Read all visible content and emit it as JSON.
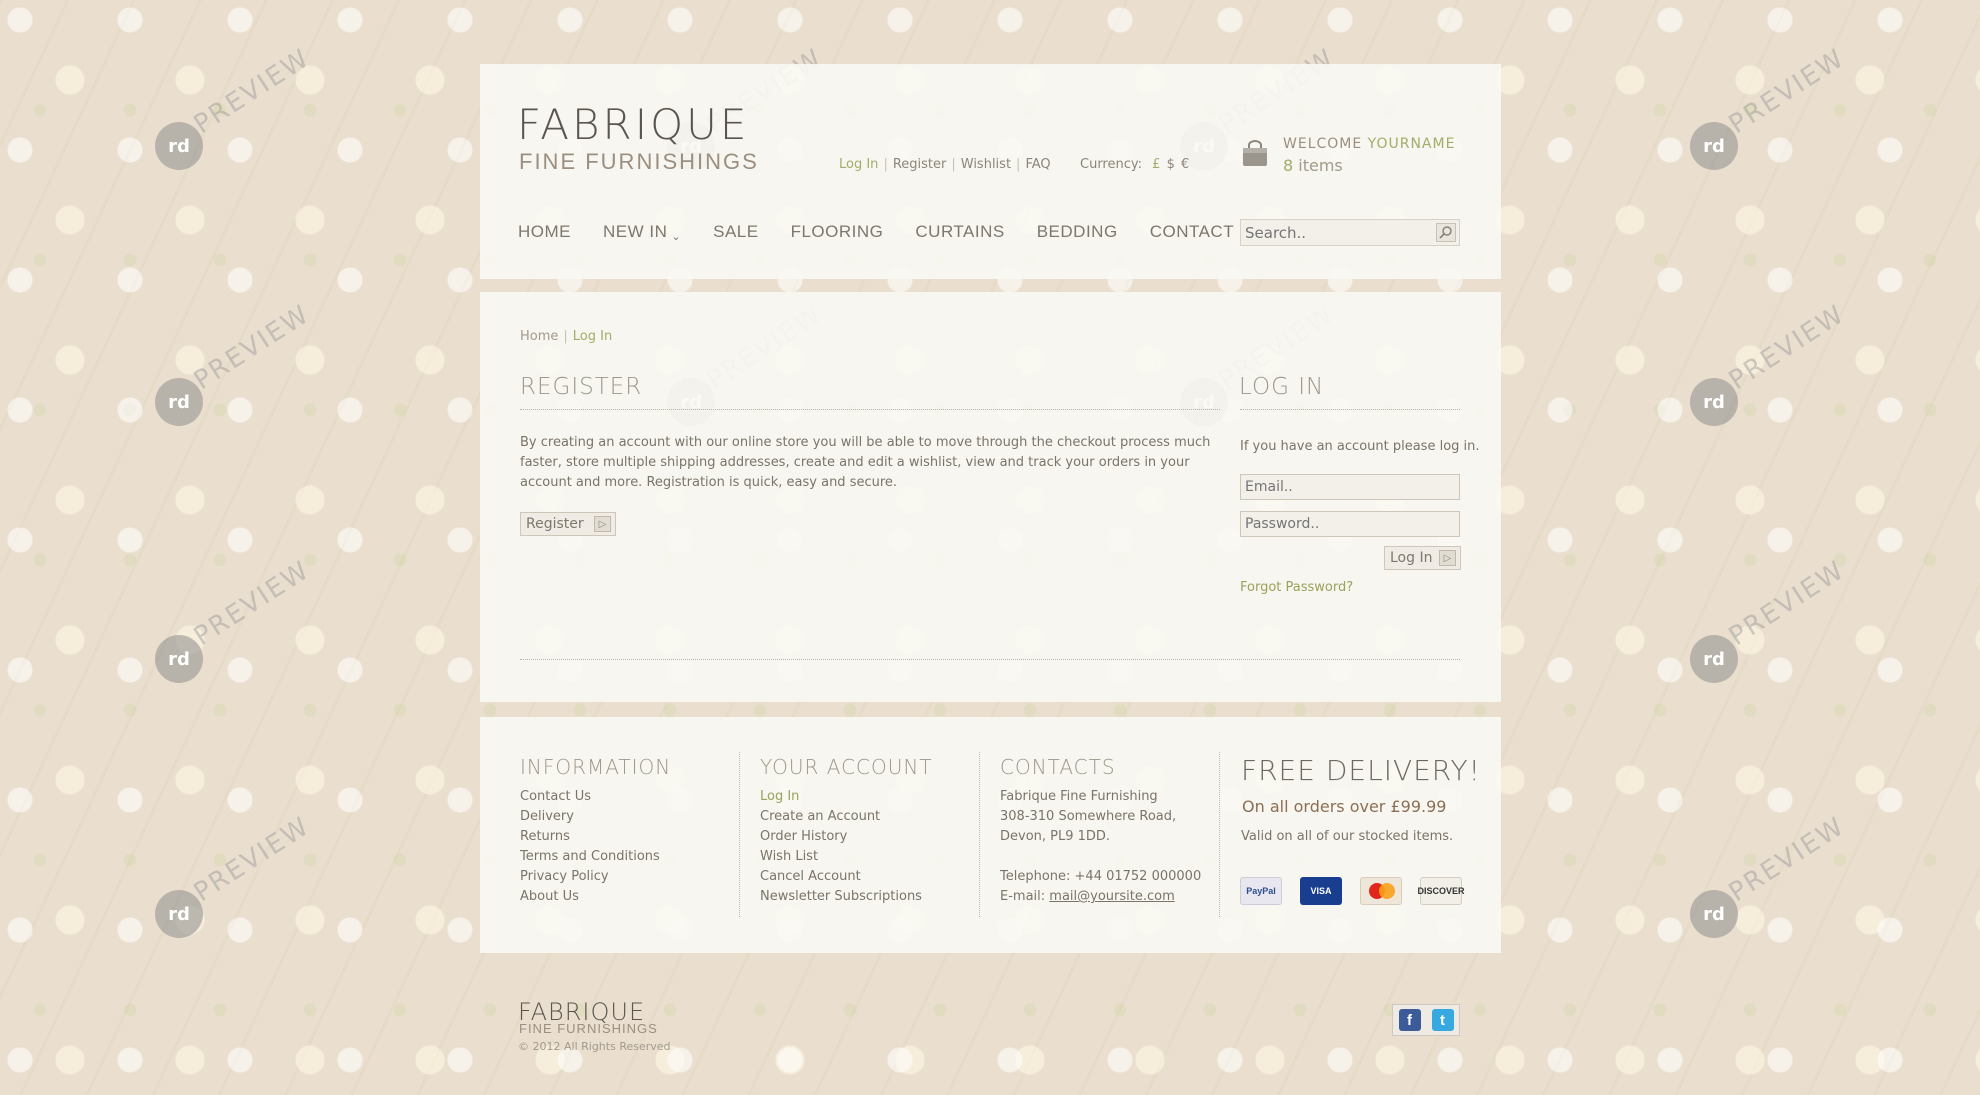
{
  "brand": {
    "title": "FABRIQUE",
    "subtitle": "FINE FURNISHINGS"
  },
  "toplinks": [
    "Log In",
    "Register",
    "Wishlist",
    "FAQ"
  ],
  "currency": {
    "label": "Currency:",
    "options": [
      "£",
      "$",
      "€"
    ]
  },
  "account": {
    "welcome": "WELCOME",
    "name": "YOURNAME",
    "count": "8",
    "items_label": "items"
  },
  "nav": {
    "home": "HOME",
    "new_in": "NEW IN",
    "sale": "SALE",
    "flooring": "FLOORING",
    "curtains": "CURTAINS",
    "bedding": "BEDDING",
    "contact": "CONTACT US"
  },
  "search": {
    "placeholder": "Search.."
  },
  "breadcrumb": {
    "home": "Home",
    "current": "Log In"
  },
  "register": {
    "title": "REGISTER",
    "text": "By creating an account with our online store you will be able to move through the checkout process much faster, store multiple shipping addresses, create and edit a wishlist, view and track your orders in your account and more. Registration is quick, easy and secure.",
    "button": "Register"
  },
  "login": {
    "title": "LOG IN",
    "info": "If you have an account please log in.",
    "email_placeholder": "Email..",
    "password_placeholder": "Password..",
    "button": "Log In",
    "forgot": "Forgot Password?"
  },
  "footer": {
    "information": {
      "title": "INFORMATION",
      "items": [
        "Contact Us",
        "Delivery",
        "Returns",
        "Terms and Conditions",
        "Privacy Policy",
        "About Us"
      ]
    },
    "your_account": {
      "title": "YOUR ACCOUNT",
      "items": [
        "Log In",
        "Create an Account",
        "Order History",
        "Wish List",
        "Cancel Account",
        "Newsletter Subscriptions"
      ]
    },
    "contacts": {
      "title": "CONTACTS",
      "company": "Fabrique Fine Furnishing",
      "address1": "308-310 Somewhere Road,",
      "address2": "Devon,  PL9 1DD.",
      "telephone": "Telephone: +44 01752 000000",
      "email_label": "E-mail: ",
      "email": "mail@yoursite.com"
    },
    "delivery": {
      "title": "FREE DELIVERY!",
      "subtitle": "On all orders over £99.99",
      "note": "Valid on all of our stocked items."
    },
    "cards": [
      "PayPal",
      "VISA",
      "MasterCard",
      "DISCOVER"
    ]
  },
  "bottom": {
    "brand": "FABRIQUE",
    "subtitle": "FINE FURNISHINGS",
    "copyright": "© 2012 All Rights Reserved"
  },
  "watermark": {
    "logo": "rd",
    "text": "PREVIEW"
  },
  "colors": {
    "accent": "#a4ac6a",
    "text": "#7a7469",
    "panel": "#f9f8f3",
    "background": "#eadfcf"
  }
}
